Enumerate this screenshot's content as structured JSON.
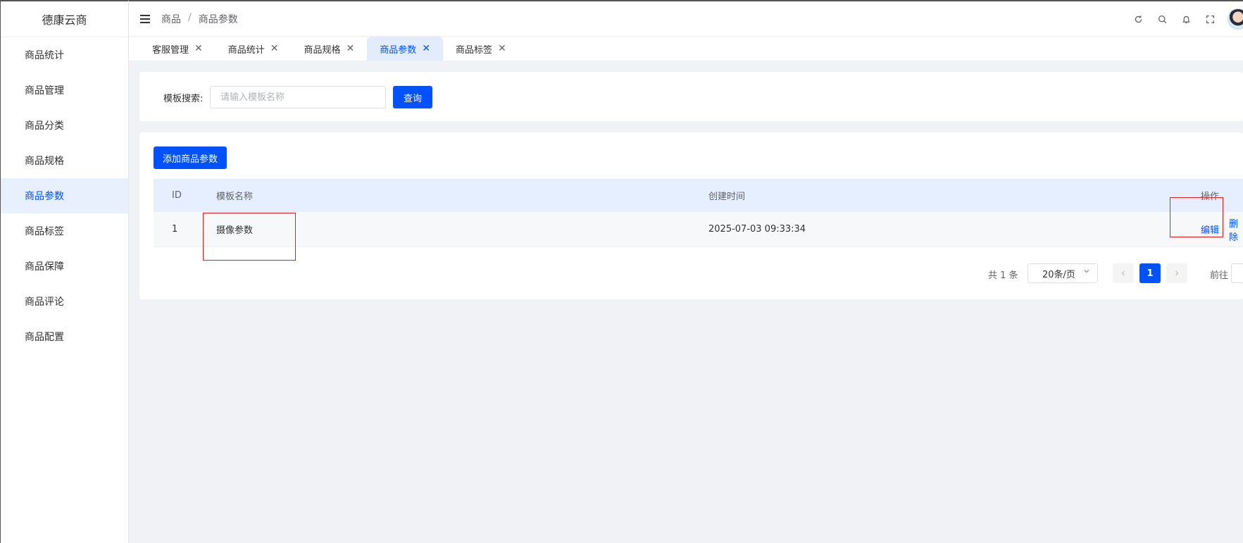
{
  "app": {
    "title": "德康云商"
  },
  "sidebar": {
    "items": [
      {
        "label": "商品统计",
        "active": false
      },
      {
        "label": "商品管理",
        "active": false
      },
      {
        "label": "商品分类",
        "active": false
      },
      {
        "label": "商品规格",
        "active": false
      },
      {
        "label": "商品参数",
        "active": true
      },
      {
        "label": "商品标签",
        "active": false
      },
      {
        "label": "商品保障",
        "active": false
      },
      {
        "label": "商品评论",
        "active": false
      },
      {
        "label": "商品配置",
        "active": false
      }
    ]
  },
  "header": {
    "breadcrumb": [
      "商品",
      "/",
      "商品参数"
    ],
    "icons": [
      "refresh-icon",
      "search-icon",
      "bell-icon",
      "fullscreen-icon"
    ]
  },
  "tabs": [
    {
      "label": "客服管理",
      "close": "✕"
    },
    {
      "label": "商品统计",
      "close": "✕"
    },
    {
      "label": "商品规格",
      "close": "✕"
    },
    {
      "label": "商品参数",
      "close": "✕",
      "active": true
    },
    {
      "label": "商品标签",
      "close": "✕"
    }
  ],
  "search": {
    "label": "模板搜索:",
    "placeholder": "请输入模板名称",
    "value": "",
    "query_label": "查询"
  },
  "toolbar": {
    "add_label": "添加商品参数"
  },
  "table": {
    "columns": [
      "ID",
      "模板名称",
      "创建时间",
      "操作"
    ],
    "rows": [
      {
        "id": "1",
        "name": "摄像参数",
        "created": "2025-07-03 09:33:34",
        "edit": "编辑",
        "delete": "删除"
      }
    ]
  },
  "pagination": {
    "total_text": "共 1 条",
    "page_size": "20条/页",
    "current_page": "1",
    "goto_label": "前往"
  },
  "colors": {
    "primary": "#0052ff",
    "annotation": "#e02020"
  }
}
